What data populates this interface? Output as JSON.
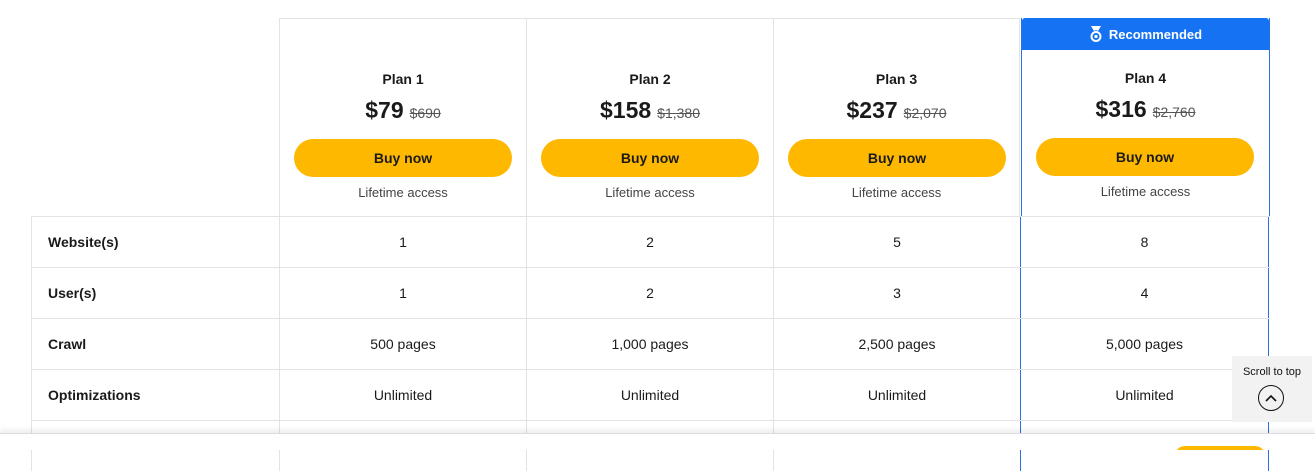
{
  "recommended_label": "Recommended",
  "plans": [
    {
      "name": "Plan 1",
      "price": "$79",
      "old_price": "$690",
      "buy_label": "Buy now",
      "access": "Lifetime access"
    },
    {
      "name": "Plan 2",
      "price": "$158",
      "old_price": "$1,380",
      "buy_label": "Buy now",
      "access": "Lifetime access"
    },
    {
      "name": "Plan 3",
      "price": "$237",
      "old_price": "$2,070",
      "buy_label": "Buy now",
      "access": "Lifetime access"
    },
    {
      "name": "Plan 4",
      "price": "$316",
      "old_price": "$2,760",
      "buy_label": "Buy now",
      "access": "Lifetime access"
    }
  ],
  "features": [
    {
      "label": "Website(s)",
      "values": [
        "1",
        "2",
        "5",
        "8"
      ]
    },
    {
      "label": "User(s)",
      "values": [
        "1",
        "2",
        "3",
        "4"
      ]
    },
    {
      "label": "Crawl",
      "values": [
        "500 pages",
        "1,000 pages",
        "2,500 pages",
        "5,000 pages"
      ]
    },
    {
      "label": "Optimizations",
      "values": [
        "Unlimited",
        "Unlimited",
        "Unlimited",
        "Unlimited"
      ]
    }
  ],
  "scroll_to_top": "Scroll to top",
  "colors": {
    "accent": "#1472f3",
    "button": "#ffb800"
  }
}
